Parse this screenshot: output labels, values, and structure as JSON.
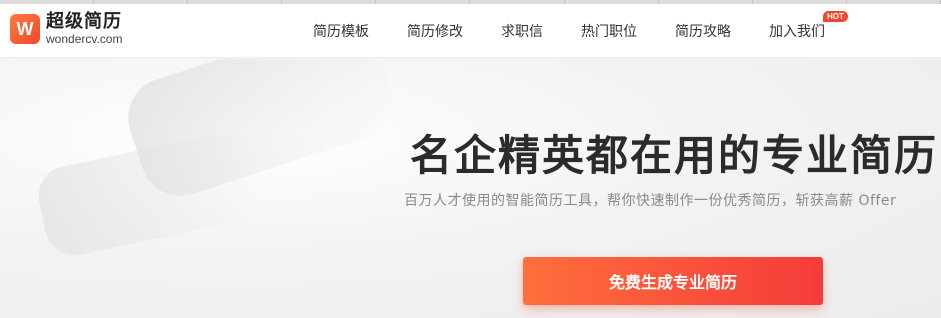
{
  "brand": {
    "logo_letter": "W",
    "name_cn": "超级简历",
    "domain": "wondercv.com",
    "accent": "#f0472e"
  },
  "nav": {
    "items": [
      {
        "label": "简历模板"
      },
      {
        "label": "简历修改"
      },
      {
        "label": "求职信"
      },
      {
        "label": "热门职位"
      },
      {
        "label": "简历攻略"
      },
      {
        "label": "加入我们",
        "badge": "HOT"
      }
    ]
  },
  "hero": {
    "title": "名企精英都在用的专业简历",
    "subtitle": "百万人才使用的智能简历工具，帮你快速制作一份优秀简历，斩获高薪 Offer",
    "cta_label": "免费生成专业简历"
  }
}
